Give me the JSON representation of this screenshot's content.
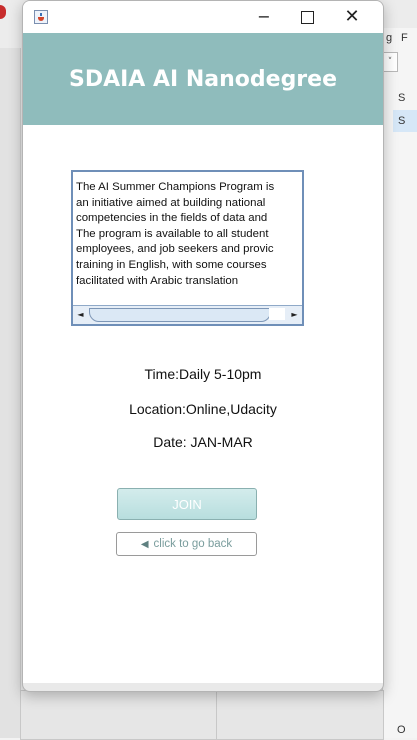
{
  "window": {
    "minimize_glyph": "−",
    "close_glyph": "✕"
  },
  "background": {
    "right_letters": [
      "g",
      "F",
      "S",
      "S",
      "O"
    ],
    "dropdown_glyph": "˅"
  },
  "header": {
    "title": "SDAIA AI Nanodegree",
    "background_color": "#8fbcbc"
  },
  "description": {
    "lines": [
      "The AI Summer Champions Program is",
      " an initiative aimed at building national",
      " competencies in the fields of data and",
      "The program is available to all student",
      "employees, and job seekers and provic",
      "training in English, with some courses",
      " facilitated with Arabic translation"
    ],
    "scroll_left_glyph": "◄",
    "scroll_right_glyph": "►"
  },
  "info": {
    "time": "Time:Daily 5-10pm",
    "location": "Location:Online,Udacity",
    "date": "Date: JAN-MAR"
  },
  "buttons": {
    "join_label": "JOIN",
    "back_label": "click to go back",
    "back_icon": "back-arrow-icon",
    "back_icon_glyph": "◀"
  }
}
